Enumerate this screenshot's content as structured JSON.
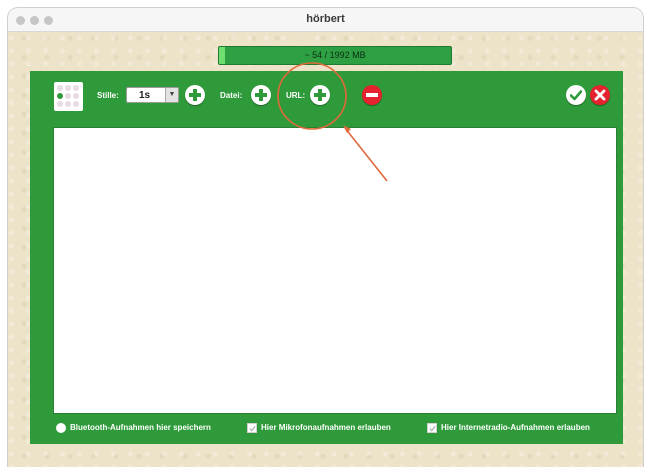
{
  "window": {
    "title": "hörbert"
  },
  "storage": {
    "text": "~ 54 / 1992 MB",
    "used_fraction": 0.027,
    "bar_color": "#2ea043"
  },
  "toolbar": {
    "silence_label": "Stille:",
    "silence_value": "1s",
    "file_label": "Datei:",
    "url_label": "URL:",
    "icons": [
      "plus-icon",
      "minus-icon",
      "checkmark-icon",
      "close-icon"
    ]
  },
  "options": {
    "bluetooth": "Bluetooth-Aufnahmen hier speichern",
    "microphone": "Hier Mikrofonaufnahmen erlauben",
    "internetradio": "Hier Internetradio-Aufnahmen erlauben"
  },
  "colors": {
    "panel": "#2f9a3a",
    "annotation": "#e06a3b",
    "delete": "#e4232e"
  }
}
